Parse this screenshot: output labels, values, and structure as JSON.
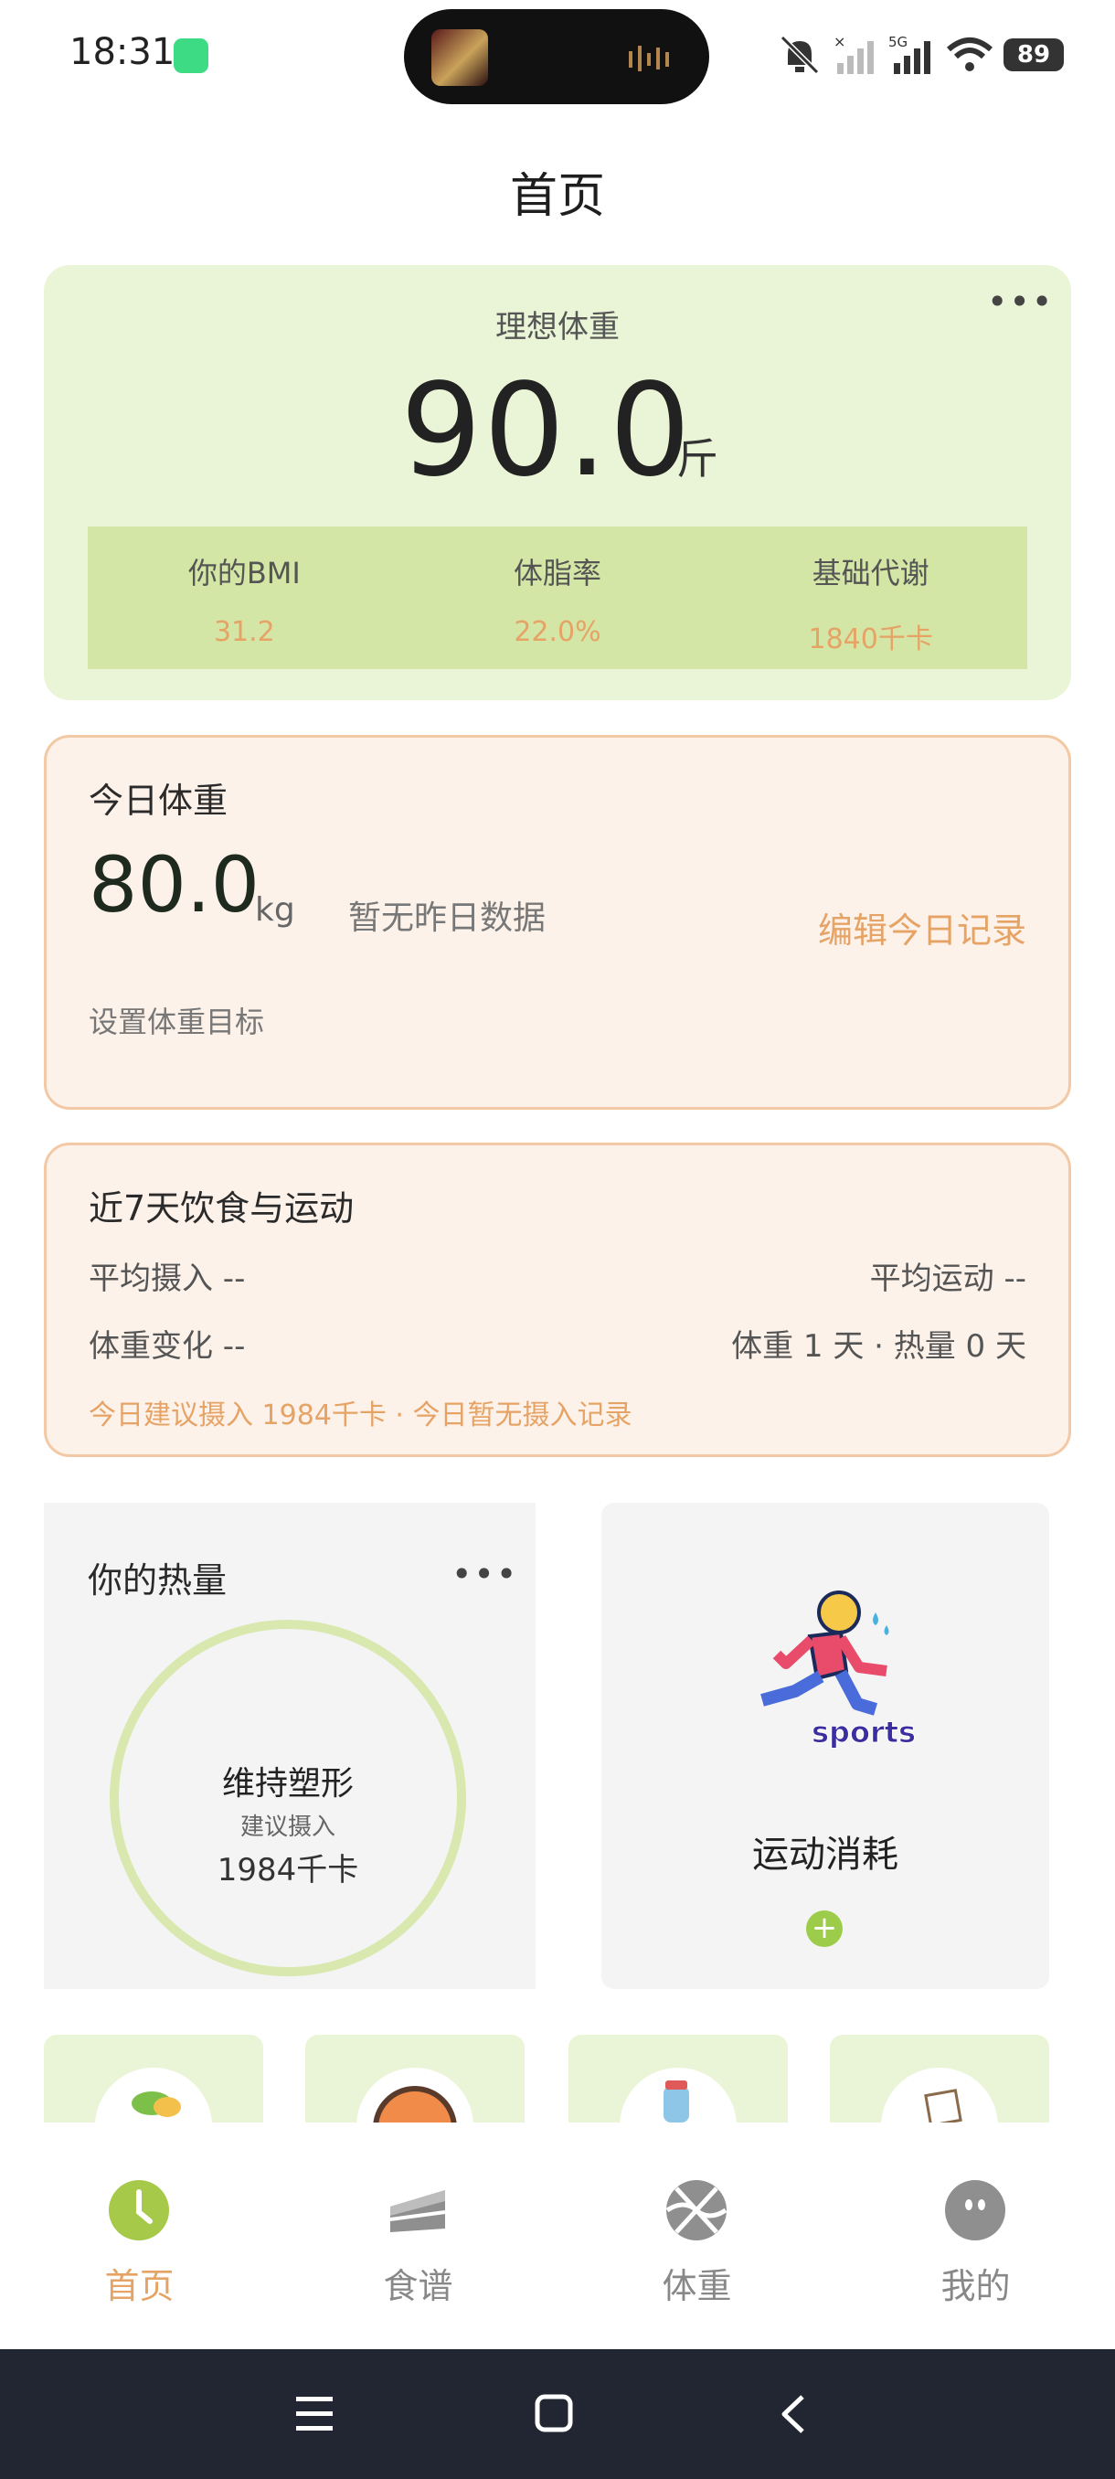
{
  "status_bar": {
    "time": "18:31",
    "battery": "89",
    "network": "5G"
  },
  "page": {
    "title": "首页"
  },
  "ideal_weight": {
    "label": "理想体重",
    "value": "90.0",
    "unit": "斤",
    "stats": [
      {
        "label": "你的BMI",
        "value": "31.2"
      },
      {
        "label": "体脂率",
        "value": "22.0%"
      },
      {
        "label": "基础代谢",
        "value": "1840千卡"
      }
    ]
  },
  "today_weight": {
    "title": "今日体重",
    "value": "80.0",
    "unit": "kg",
    "no_yesterday": "暂无昨日数据",
    "edit_label": "编辑今日记录",
    "set_goal_label": "设置体重目标"
  },
  "week_summary": {
    "title": "近7天饮食与运动",
    "avg_intake": "平均摄入 --",
    "avg_exercise": "平均运动 --",
    "weight_change": "体重变化 --",
    "record_days": "体重 1 天 · 热量 0 天",
    "tip": "今日建议摄入 1984千卡 · 今日暂无摄入记录"
  },
  "calorie": {
    "title": "你的热量",
    "goal": "维持塑形",
    "suggest_label": "建议摄入",
    "suggest_value": "1984千卡"
  },
  "sports": {
    "badge": "sports",
    "label": "运动消耗",
    "plus": "+"
  },
  "bottom_nav": {
    "items": [
      {
        "label": "首页",
        "icon": "clock-icon",
        "active": true
      },
      {
        "label": "食谱",
        "icon": "cake-icon",
        "active": false
      },
      {
        "label": "体重",
        "icon": "basketball-icon",
        "active": false
      },
      {
        "label": "我的",
        "icon": "face-icon",
        "active": false
      }
    ]
  },
  "colors": {
    "accent": "#e6a366",
    "green_card": "#eaf5d7",
    "green_band": "#d4e6a5",
    "peach_card": "#fdf2ea",
    "peach_border": "#f3c9a5",
    "active_icon": "#a6c94a"
  }
}
